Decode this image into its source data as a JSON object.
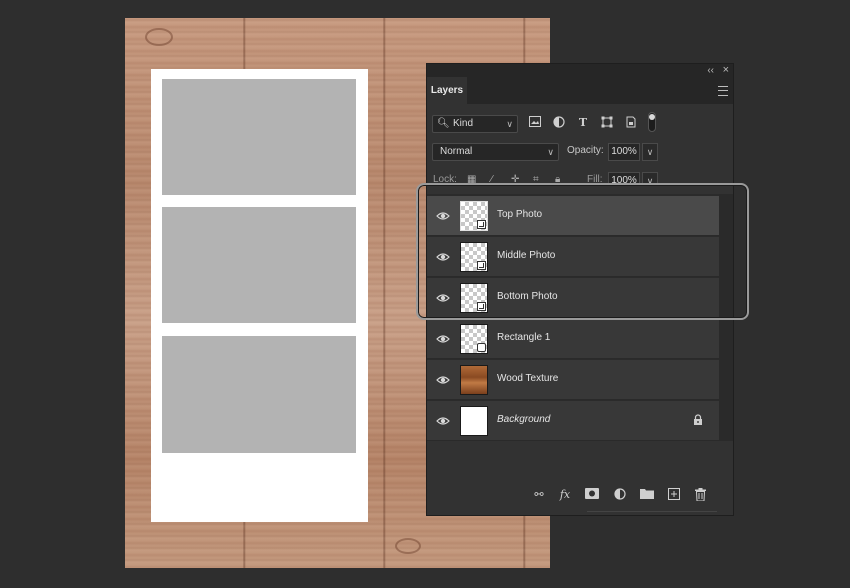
{
  "panel": {
    "tab_label": "Layers",
    "collapse_glyph": "‹‹",
    "close_glyph": "×",
    "kind_filter": {
      "label": "Kind"
    },
    "blend_mode": "Normal",
    "opacity_label": "Opacity:",
    "opacity_value": "100%",
    "lock_label": "Lock:",
    "fill_label": "Fill:",
    "fill_value": "100%"
  },
  "layers": [
    {
      "name": "Top Photo",
      "thumb": "checker",
      "badge": "smart-object",
      "selected": true,
      "visible": true
    },
    {
      "name": "Middle Photo",
      "thumb": "checker",
      "badge": "smart-object",
      "selected": false,
      "visible": true
    },
    {
      "name": "Bottom Photo",
      "thumb": "checker",
      "badge": "smart-object",
      "selected": false,
      "visible": true
    },
    {
      "name": "Rectangle 1",
      "thumb": "checker",
      "badge": "shape",
      "selected": false,
      "visible": true
    },
    {
      "name": "Wood Texture",
      "thumb": "wood",
      "badge": "",
      "selected": false,
      "visible": true
    },
    {
      "name": "Background",
      "thumb": "white",
      "badge": "",
      "selected": false,
      "visible": true,
      "locked": true
    }
  ],
  "bottom_bar_icons": [
    "link-icon",
    "fx-icon",
    "mask-icon",
    "adjustment-icon",
    "folder-icon",
    "new-layer-icon",
    "trash-icon"
  ],
  "colors": {
    "app_bg": "#2e2e2e",
    "panel_bg": "#323232",
    "selected_row": "#4a4a4a",
    "photo_placeholder": "#b3b3b3"
  }
}
